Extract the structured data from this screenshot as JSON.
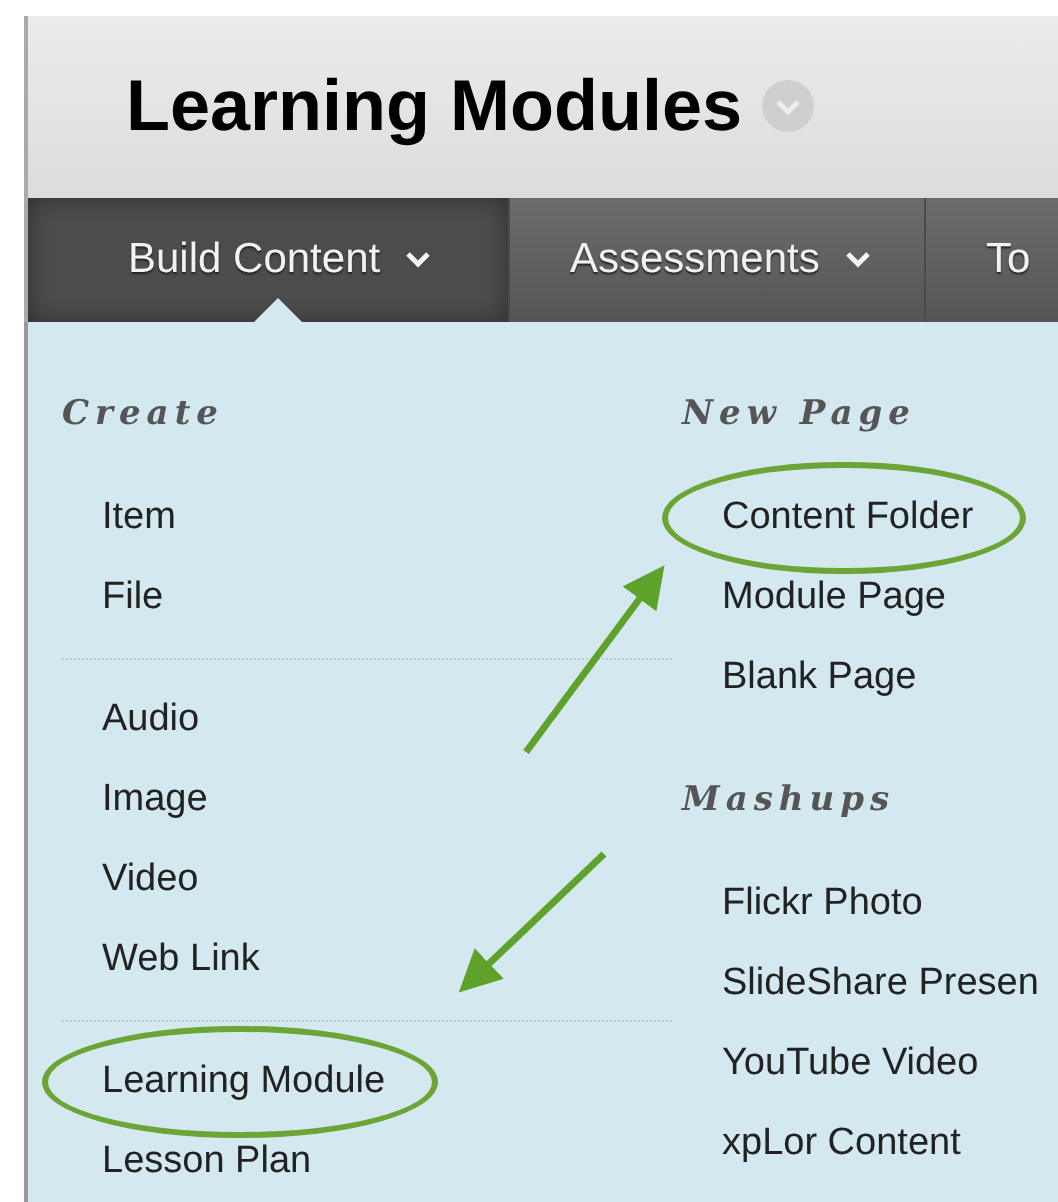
{
  "page_title": "Learning Modules",
  "tabs": [
    {
      "label": "Build Content",
      "selected": true,
      "dropdown": true
    },
    {
      "label": "Assessments",
      "selected": false,
      "dropdown": true
    },
    {
      "label": "To",
      "selected": false,
      "dropdown": false
    }
  ],
  "menu_columns": [
    [
      {
        "heading": "Create",
        "groups": [
          [
            {
              "label": "Item",
              "circled": false
            },
            {
              "label": "File",
              "circled": false
            }
          ],
          [
            {
              "label": "Audio",
              "circled": false
            },
            {
              "label": "Image",
              "circled": false
            },
            {
              "label": "Video",
              "circled": false
            },
            {
              "label": "Web Link",
              "circled": false
            }
          ],
          [
            {
              "label": "Learning Module",
              "circled": true
            },
            {
              "label": "Lesson Plan",
              "circled": false
            }
          ]
        ]
      }
    ],
    [
      {
        "heading": "New Page",
        "groups": [
          [
            {
              "label": "Content Folder",
              "circled": true
            },
            {
              "label": "Module Page",
              "circled": false
            },
            {
              "label": "Blank Page",
              "circled": false
            }
          ]
        ]
      },
      {
        "heading": "Mashups",
        "groups": [
          [
            {
              "label": "Flickr Photo",
              "circled": false
            },
            {
              "label": "SlideShare Presen",
              "circled": false
            },
            {
              "label": "YouTube Video",
              "circled": false
            },
            {
              "label": "xpLor Content",
              "circled": false
            }
          ]
        ]
      }
    ]
  ]
}
